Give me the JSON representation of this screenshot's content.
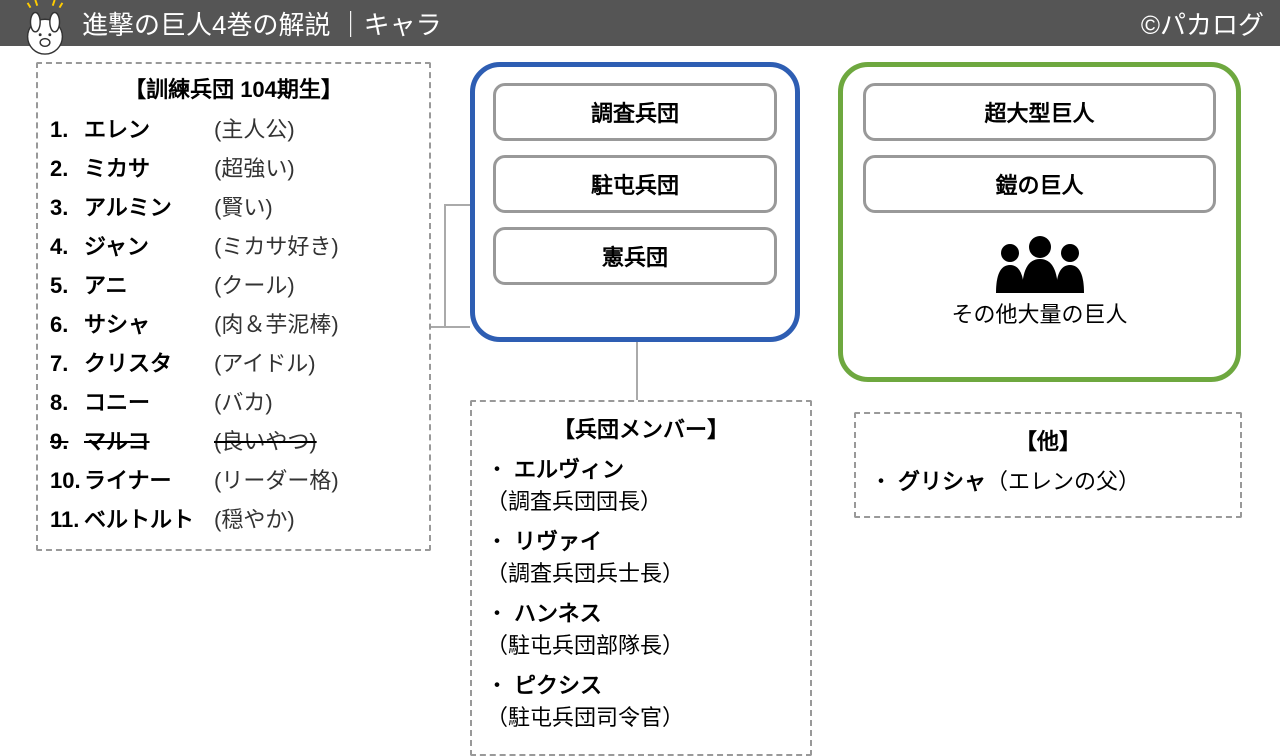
{
  "header": {
    "title": "進撃の巨人4巻の解説 ｜キャラ",
    "credit": "©パカログ"
  },
  "cadets": {
    "title": "【訓練兵団 104期生】",
    "items": [
      {
        "num": "1.",
        "name": "エレン",
        "note": "(主人公)",
        "strike": false
      },
      {
        "num": "2.",
        "name": "ミカサ",
        "note": "(超強い)",
        "strike": false
      },
      {
        "num": "3.",
        "name": "アルミン",
        "note": "(賢い)",
        "strike": false
      },
      {
        "num": "4.",
        "name": "ジャン",
        "note": "(ミカサ好き)",
        "strike": false
      },
      {
        "num": "5.",
        "name": "アニ",
        "note": "(クール)",
        "strike": false
      },
      {
        "num": "6.",
        "name": "サシャ",
        "note": "(肉＆芋泥棒)",
        "strike": false
      },
      {
        "num": "7.",
        "name": "クリスタ",
        "note": "(アイドル)",
        "strike": false
      },
      {
        "num": "8.",
        "name": "コニー",
        "note": "(バカ)",
        "strike": false
      },
      {
        "num": "9.",
        "name": "マルコ",
        "note": "(良いやつ)",
        "strike": true
      },
      {
        "num": "10.",
        "name": "ライナー",
        "note": "(リーダー格)",
        "strike": false
      },
      {
        "num": "11.",
        "name": "ベルトルト",
        "note": "(穏やか)",
        "strike": false
      }
    ]
  },
  "corps": {
    "items": [
      "調査兵団",
      "駐屯兵団",
      "憲兵団"
    ]
  },
  "titans": {
    "items": [
      "超大型巨人",
      "鎧の巨人"
    ],
    "other": "その他大量の巨人"
  },
  "members": {
    "title": "【兵団メンバー】",
    "items": [
      {
        "name": "エルヴィン",
        "note": "（調査兵団団長）"
      },
      {
        "name": "リヴァイ",
        "note": "（調査兵団兵士長）"
      },
      {
        "name": "ハンネス",
        "note": "（駐屯兵団部隊長）"
      },
      {
        "name": "ピクシス",
        "note": "（駐屯兵団司令官）"
      }
    ]
  },
  "others": {
    "title": "【他】",
    "items": [
      {
        "name": "グリシャ",
        "note": "（エレンの父）"
      }
    ]
  }
}
